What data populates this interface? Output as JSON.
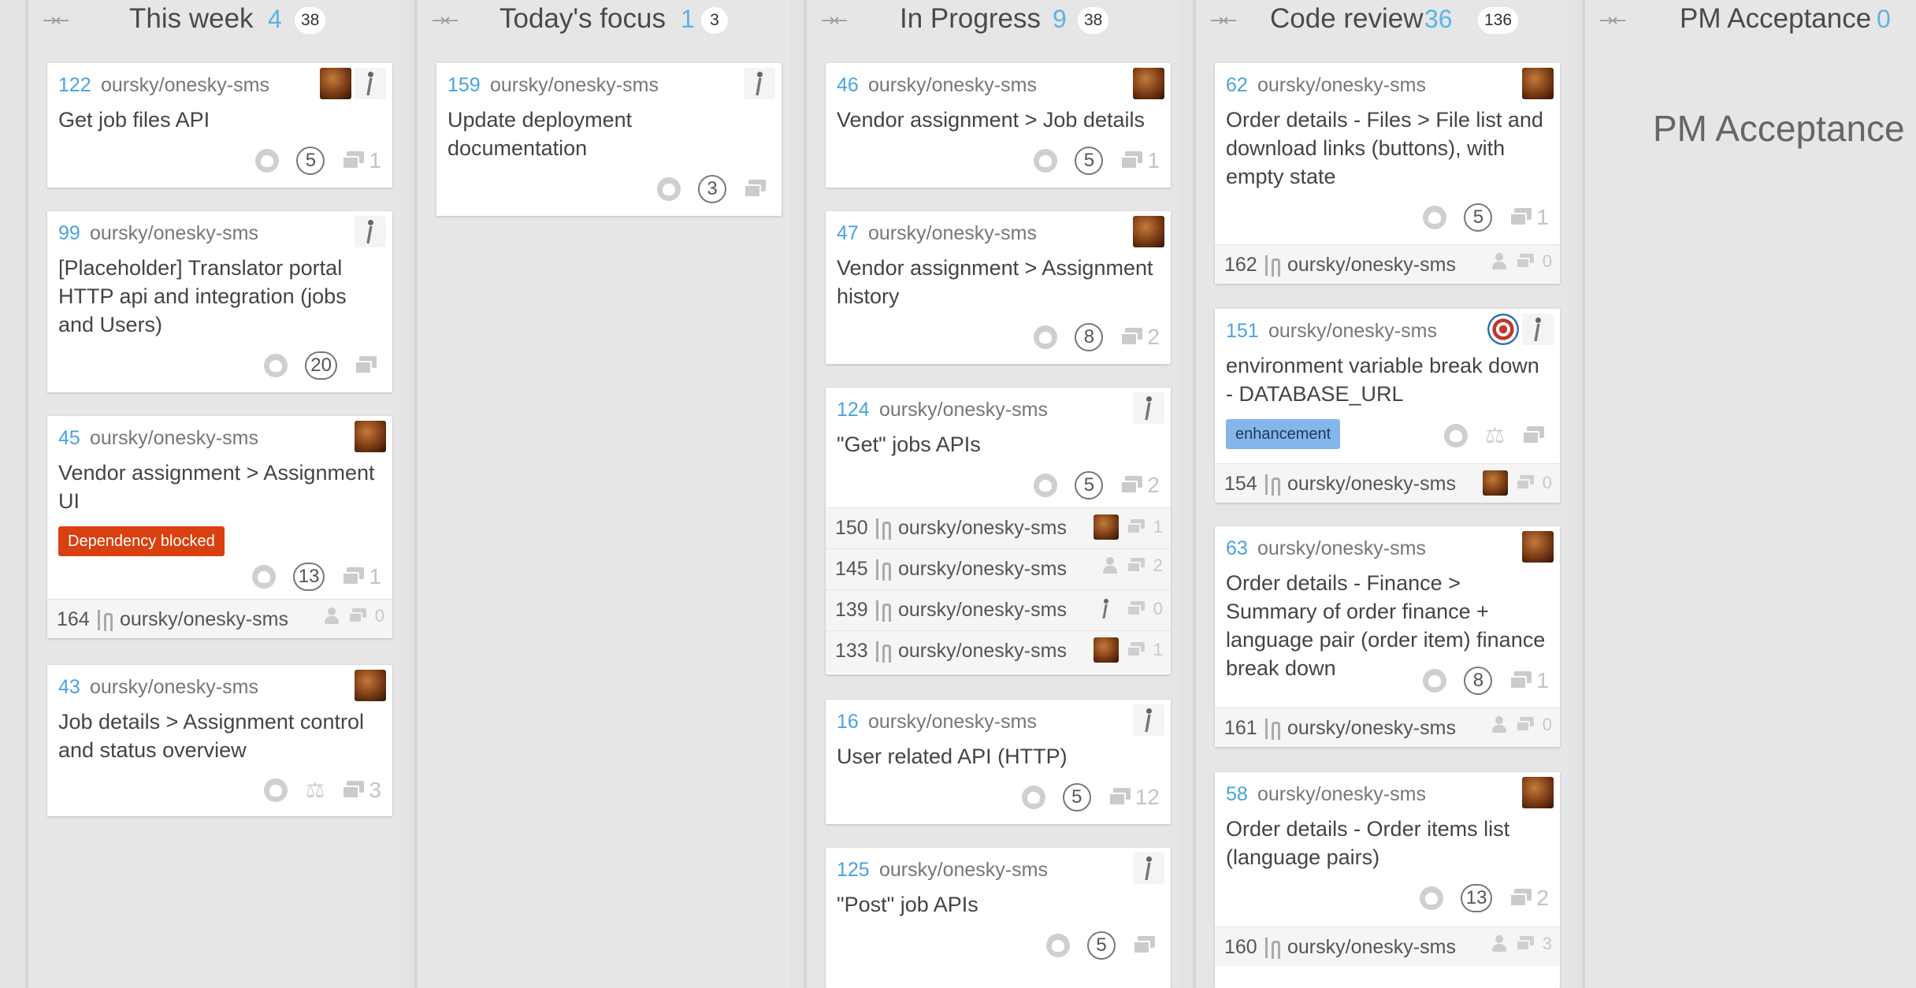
{
  "columns": [
    {
      "title": "This week",
      "issues": "4",
      "points": "38"
    },
    {
      "title": "Today's focus",
      "issues": "1",
      "points": "3"
    },
    {
      "title": "In Progress",
      "issues": "9",
      "points": "38"
    },
    {
      "title": "Code review",
      "issues": "36",
      "points": "136"
    },
    {
      "title": "PM Acceptance",
      "issues": "0",
      "body_title": "PM Acceptance"
    }
  ],
  "cards": {
    "c122": {
      "num": "122",
      "repo": "oursky/onesky-sms",
      "title": "Get job files API",
      "estimate": "5",
      "comments": "1",
      "avatars": [
        "brown-avatar",
        "walker-avatar"
      ]
    },
    "c99": {
      "num": "99",
      "repo": "oursky/onesky-sms",
      "title": "[Placeholder] Translator portal HTTP api and integration (jobs and Users)",
      "estimate": "20",
      "comments": ""
    },
    "c45": {
      "num": "45",
      "repo": "oursky/onesky-sms",
      "title": "Vendor assignment > Assignment UI",
      "label": "Dependency blocked",
      "label_color": "#d9400f",
      "estimate": "13",
      "comments": "1",
      "sub": {
        "num": "164",
        "repo": "oursky/onesky-sms",
        "comments": "0"
      }
    },
    "c43": {
      "num": "43",
      "repo": "oursky/onesky-sms",
      "title": "Job details > Assignment control and status overview",
      "comments": "3"
    },
    "c159": {
      "num": "159",
      "repo": "oursky/onesky-sms",
      "title": "Update deployment documentation",
      "estimate": "3",
      "comments": ""
    },
    "c46": {
      "num": "46",
      "repo": "oursky/onesky-sms",
      "title": "Vendor assignment > Job details",
      "estimate": "5",
      "comments": "1"
    },
    "c47": {
      "num": "47",
      "repo": "oursky/onesky-sms",
      "title": "Vendor assignment > Assignment history",
      "estimate": "8",
      "comments": "2"
    },
    "c124": {
      "num": "124",
      "repo": "oursky/onesky-sms",
      "title": "\"Get\" jobs APIs",
      "estimate": "5",
      "comments": "2",
      "subs": [
        {
          "num": "150",
          "repo": "oursky/onesky-sms",
          "comments": "1"
        },
        {
          "num": "145",
          "repo": "oursky/onesky-sms",
          "comments": "2"
        },
        {
          "num": "139",
          "repo": "oursky/onesky-sms",
          "comments": "0"
        },
        {
          "num": "133",
          "repo": "oursky/onesky-sms",
          "comments": "1"
        }
      ]
    },
    "c16": {
      "num": "16",
      "repo": "oursky/onesky-sms",
      "title": "User related API (HTTP)",
      "estimate": "5",
      "comments": "12"
    },
    "c125": {
      "num": "125",
      "repo": "oursky/onesky-sms",
      "title": "\"Post\" job APIs",
      "estimate": "5",
      "comments": ""
    },
    "c62": {
      "num": "62",
      "repo": "oursky/onesky-sms",
      "title": "Order details - Files > File list and download links (buttons), with empty state",
      "estimate": "5",
      "comments": "1",
      "sub": {
        "num": "162",
        "repo": "oursky/onesky-sms",
        "comments": "0"
      }
    },
    "c151": {
      "num": "151",
      "repo": "oursky/onesky-sms",
      "title": "environment variable break down - DATABASE_URL",
      "label": "enhancement",
      "label_color": "#84b6eb",
      "comments": "",
      "sub": {
        "num": "154",
        "repo": "oursky/onesky-sms",
        "comments": "0"
      }
    },
    "c63": {
      "num": "63",
      "repo": "oursky/onesky-sms",
      "title": "Order details - Finance > Summary of order finance + language pair (order item) finance break down",
      "estimate": "8",
      "comments": "1",
      "sub": {
        "num": "161",
        "repo": "oursky/onesky-sms",
        "comments": "0"
      }
    },
    "c58": {
      "num": "58",
      "repo": "oursky/onesky-sms",
      "title": "Order details - Order items list (language pairs)",
      "estimate": "13",
      "comments": "2",
      "sub": {
        "num": "160",
        "repo": "oursky/onesky-sms",
        "comments": "3"
      }
    }
  }
}
